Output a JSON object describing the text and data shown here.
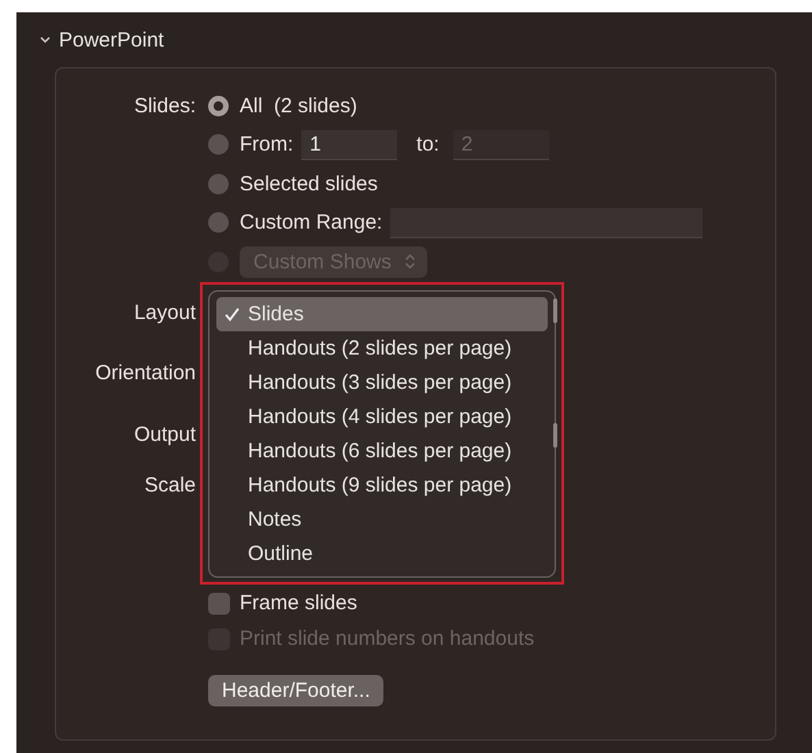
{
  "section": {
    "title": "PowerPoint",
    "expanded": true
  },
  "slides": {
    "label": "Slides:",
    "options": [
      {
        "kind": "plain",
        "label": "All  (2 slides)",
        "selected": true,
        "disabled": false
      },
      {
        "kind": "range",
        "label": "From:",
        "value": "1",
        "to_label": "to:",
        "to_value": "2",
        "to_disabled": true,
        "selected": false,
        "disabled": false
      },
      {
        "kind": "plain",
        "label": "Selected slides",
        "selected": false,
        "disabled": false
      },
      {
        "kind": "field",
        "label": "Custom Range:",
        "selected": false,
        "disabled": false
      },
      {
        "kind": "popup",
        "label": "Custom Shows",
        "selected": false,
        "disabled": true
      }
    ]
  },
  "field_labels": [
    "Layout",
    "Orientation",
    "Output",
    "Scale"
  ],
  "layout_menu": {
    "items": [
      {
        "label": "Slides",
        "selected": true
      },
      {
        "label": "Handouts (2 slides per page)",
        "selected": false
      },
      {
        "label": "Handouts (3 slides per page)",
        "selected": false
      },
      {
        "label": "Handouts (4 slides per page)",
        "selected": false
      },
      {
        "label": "Handouts (6 slides per page)",
        "selected": false
      },
      {
        "label": "Handouts (9 slides per page)",
        "selected": false
      },
      {
        "label": "Notes",
        "selected": false
      },
      {
        "label": "Outline",
        "selected": false
      }
    ]
  },
  "checkboxes": [
    {
      "label": "Frame slides",
      "checked": false,
      "disabled": false
    },
    {
      "label": "Print slide numbers on handouts",
      "checked": false,
      "disabled": true
    }
  ],
  "buttons": [
    {
      "label": "Header/Footer..."
    }
  ]
}
